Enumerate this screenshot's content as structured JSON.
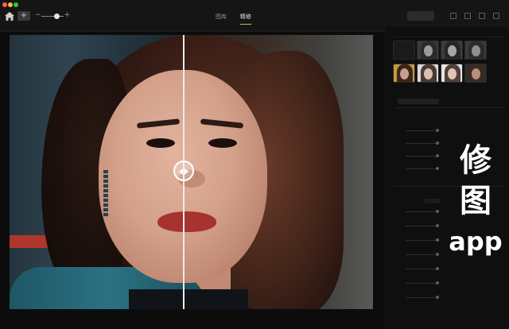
{
  "titlebar": {
    "add_label": "+",
    "zoom_minus": "−",
    "zoom_plus": "+",
    "tabs": [
      {
        "label": "图库"
      },
      {
        "label": "精修"
      }
    ],
    "active_tab": "精修",
    "accent_color": "#d7b24a"
  },
  "overlay_caption": {
    "line1": "修",
    "line2": "图",
    "line3": "app"
  },
  "colors": {
    "background": "#0c0c0c",
    "panel": "#0f0f0f",
    "split_line": "#ececec"
  }
}
